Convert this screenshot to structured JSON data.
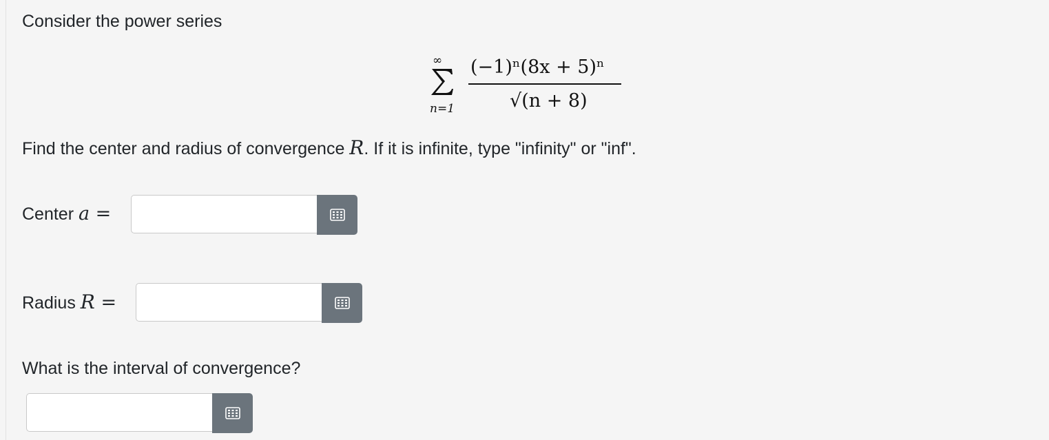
{
  "question": {
    "intro": "Consider the power series",
    "formula": {
      "sum_upper": "∞",
      "sum_lower": "n=1",
      "numerator": "(−1)ⁿ(8x + 5)ⁿ",
      "denominator": "√(n + 8)"
    },
    "instruction_before": "Find the center and radius of convergence ",
    "instruction_var": "R",
    "instruction_after": ". If it is infinite, type \"infinity\" or \"inf\".",
    "center_label": "Center ",
    "center_var": "a",
    "center_eq": " =",
    "radius_label": "Radius ",
    "radius_var": "R",
    "radius_eq": " =",
    "interval_question": "What is the interval of convergence?"
  },
  "inputs": {
    "center_value": "",
    "radius_value": "",
    "interval_value": ""
  },
  "icons": {
    "keypad": "keyboard-icon"
  },
  "colors": {
    "background": "#f5f5f5",
    "keypad_button": "#6b747c"
  }
}
